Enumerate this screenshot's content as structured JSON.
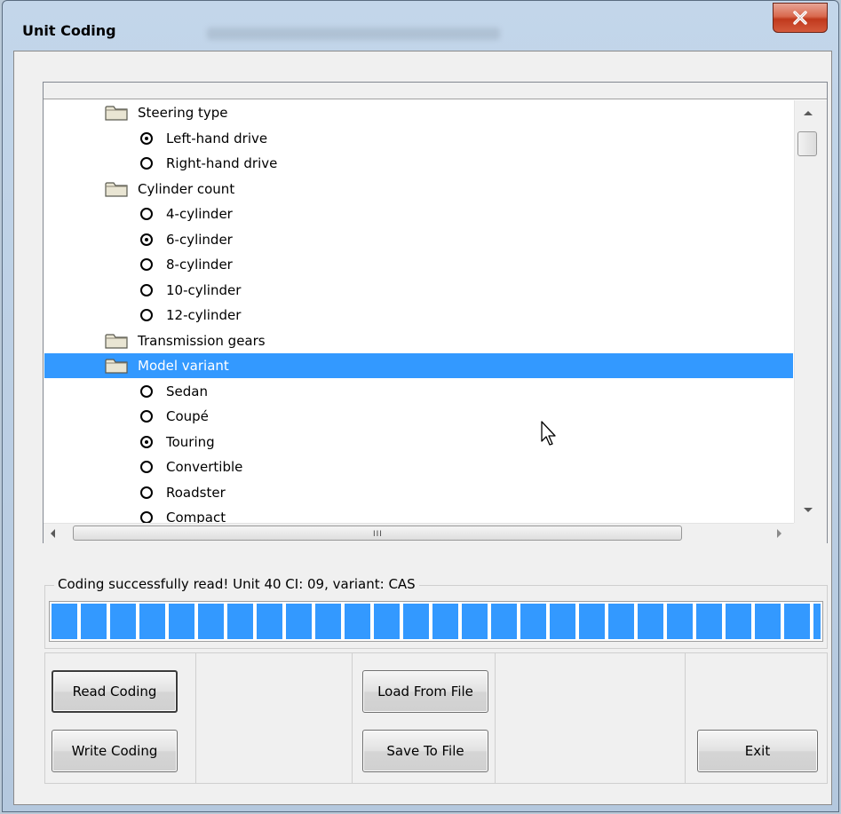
{
  "window": {
    "title": "Unit Coding"
  },
  "tree": {
    "items": [
      {
        "type": "folder",
        "label": "Steering type"
      },
      {
        "type": "option",
        "label": "Left-hand drive",
        "checked": true
      },
      {
        "type": "option",
        "label": "Right-hand drive",
        "checked": false
      },
      {
        "type": "folder",
        "label": "Cylinder count"
      },
      {
        "type": "option",
        "label": "4-cylinder",
        "checked": false
      },
      {
        "type": "option",
        "label": "6-cylinder",
        "checked": true
      },
      {
        "type": "option",
        "label": "8-cylinder",
        "checked": false
      },
      {
        "type": "option",
        "label": "10-cylinder",
        "checked": false
      },
      {
        "type": "option",
        "label": "12-cylinder",
        "checked": false
      },
      {
        "type": "folder",
        "label": "Transmission gears"
      },
      {
        "type": "folder",
        "label": "Model variant",
        "selected": true
      },
      {
        "type": "option",
        "label": "Sedan",
        "checked": false
      },
      {
        "type": "option",
        "label": "Coupé",
        "checked": false
      },
      {
        "type": "option",
        "label": "Touring",
        "checked": true
      },
      {
        "type": "option",
        "label": "Convertible",
        "checked": false
      },
      {
        "type": "option",
        "label": "Roadster",
        "checked": false
      },
      {
        "type": "option",
        "label": "Compact",
        "checked": false
      }
    ],
    "hscroll_grip": "III"
  },
  "status": {
    "text": "Coding successfully read! Unit 40 CI: 09, variant: CAS",
    "progress": 1.0,
    "progress_color": "#3399ff"
  },
  "buttons": {
    "read_coding": "Read Coding",
    "write_coding": "Write Coding",
    "load_from_file": "Load From File",
    "save_to_file": "Save To File",
    "exit": "Exit"
  },
  "colors": {
    "selection": "#3399ff",
    "close_button": "#c8442a"
  }
}
